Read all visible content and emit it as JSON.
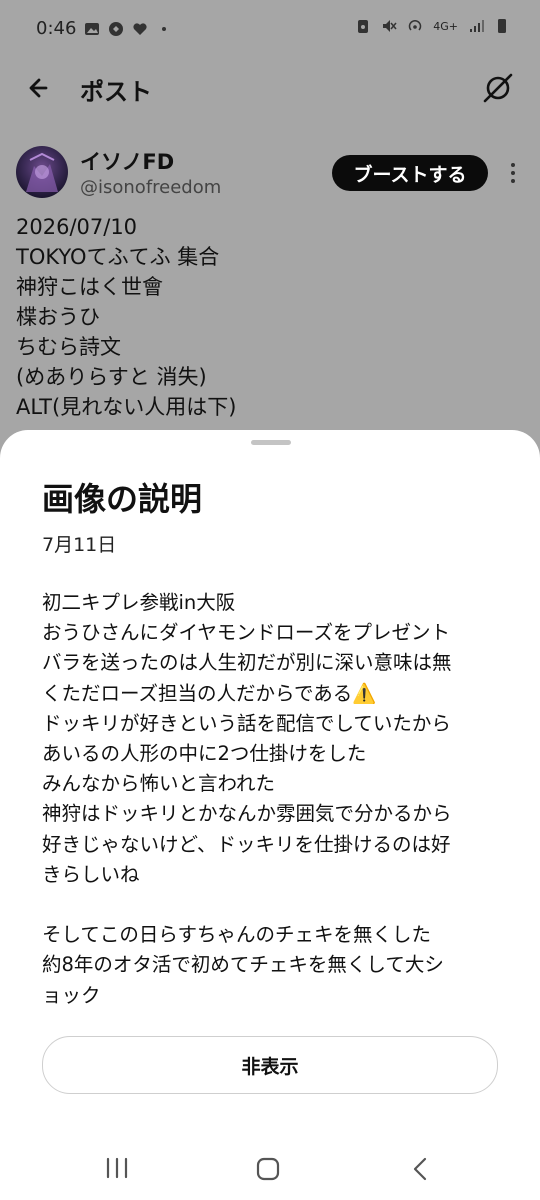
{
  "status_bar": {
    "time": "0:46",
    "network": "4G+"
  },
  "app_bar": {
    "title": "ポスト"
  },
  "post": {
    "display_name": "イソノFD",
    "handle": "@isonofreedom",
    "boost_label": "ブーストする",
    "lines": [
      "2026/07/10",
      "TOKYOてふてふ 集合",
      "神狩こはく世會",
      "楪おうひ",
      "ちむら詩文",
      "(めありらすと 消失)",
      "ALT(見れない人用は下)"
    ]
  },
  "sheet": {
    "title": "画像の説明",
    "date": "7月11日",
    "description_lines": [
      "初二キプレ参戦in大阪",
      "おうひさんにダイヤモンドローズをプレゼント",
      "バラを送ったのは人生初だが別に深い意味は無",
      "くただローズ担当の人だからである⚠️",
      "ドッキリが好きという話を配信でしていたから",
      "あいるの人形の中に2つ仕掛けをした",
      "みんなから怖いと言われた",
      "神狩はドッキリとかなんか雰囲気で分かるから",
      "好きじゃないけど、ドッキリを仕掛けるのは好",
      "きらしいね",
      "",
      "そしてこの日らすちゃんのチェキを無くした",
      "約8年のオタ活で初めてチェキを無くして大シ",
      "ョック"
    ],
    "hide_label": "非表示"
  }
}
